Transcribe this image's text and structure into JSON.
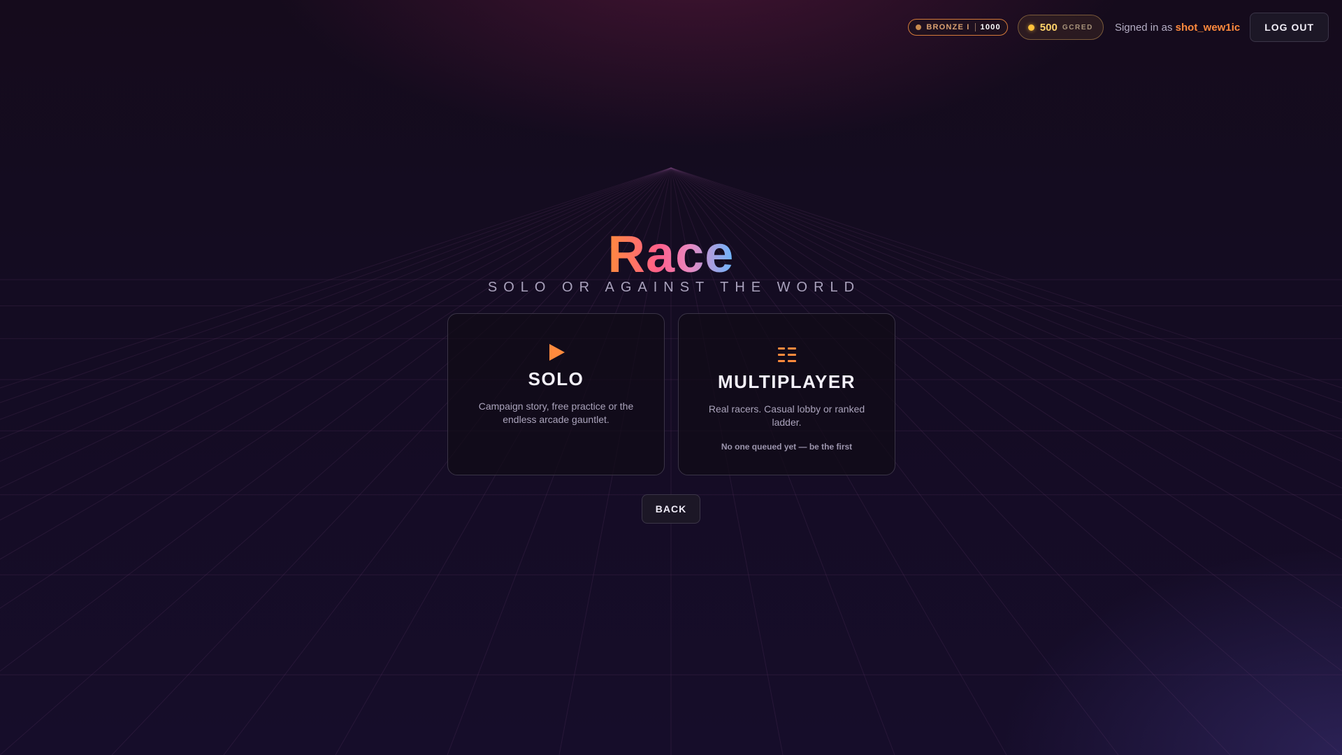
{
  "header": {
    "rank": {
      "tier": "BRONZE I",
      "points": "1000"
    },
    "credits": {
      "amount": "500",
      "unit": "GCRED"
    },
    "signed_in_prefix": "Signed in as",
    "username": "shot_wew1ic",
    "logout_label": "LOG OUT"
  },
  "hero": {
    "title": "Race",
    "subtitle": "SOLO OR AGAINST THE WORLD"
  },
  "modes": [
    {
      "icon": "play-icon",
      "title": "SOLO",
      "description": "Campaign story, free practice or the endless arcade gauntlet."
    },
    {
      "icon": "lobby-list-icon",
      "title": "MULTIPLAYER",
      "description": "Real racers. Casual lobby or ranked ladder.",
      "status": "No one queued yet — be the first"
    }
  ],
  "back_label": "BACK",
  "colors": {
    "accent": "#ff8a3d",
    "coin": "#ffc23a",
    "background": "#150c20"
  }
}
